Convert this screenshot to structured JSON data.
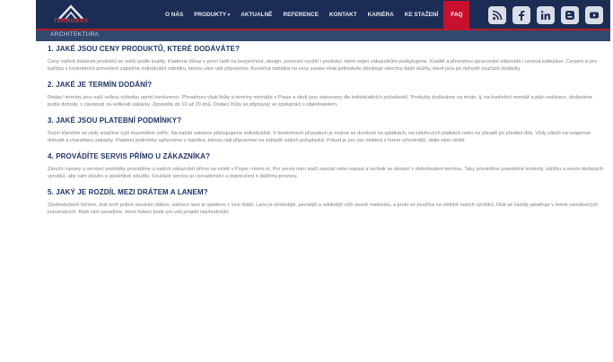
{
  "header": {
    "logo_text": "TERMOBOX",
    "nav": [
      {
        "label": "O NÁS"
      },
      {
        "label": "PRODUKTY",
        "caret": "▾"
      },
      {
        "label": "AKTUALNĚ"
      },
      {
        "label": "REFERENCE"
      },
      {
        "label": "KONTAKT"
      },
      {
        "label": "KARIÉRA"
      },
      {
        "label": "KE STAŽENÍ"
      },
      {
        "label": "FAQ",
        "active": true
      }
    ],
    "social_icons": [
      "rss-icon",
      "facebook-icon",
      "linkedin-icon",
      "blogger-icon",
      "youtube-icon"
    ]
  },
  "subbar": {
    "label": "ARCHITEKTURA"
  },
  "faq": [
    {
      "question": "1. JAKÉ JSOU CENY PRODUKTŮ, KTERÉ DODÁVÁTE?",
      "answer": "Ceny našich dodávek produktů se neliší podle kvality. Klademe důraz v první řadě na bezpečnost, design, provozní využití i produkci, které nejen zákazníkům poskytujeme. Kvalitě a přesnému zpracování odpovídá i cenová kalkulace. Cenami si pro každou z konkrétních provedení zajistíme individuální nabídku, kterou vám rádi připravíme. Konečná nabídka na ceny sestav však jednoduše obsahuje všechny další služby, které jsou po dohodě součástí dodávky."
    },
    {
      "question": "2. JAKÉ JE TERMÍN DODÁNÍ?",
      "answer": "Dodací termíny jsou naší velkou výhodou oproti konkurenci. Přesahnou však lhůty a termíny montáže v Praze a okolí jsou stanoveny dle individuálních požadavků. Produkty dodáváme na místo, tj. na konkrétní montáž a plán realizace, dodáváme podle dohody, v závislosti na velikosti zakázky. Zpravidla do 10 až 20 dnů. Dodací lhůty se připravují ve spolupráci s objednatelem."
    },
    {
      "question": "3. JAKÉ JSOU PLATEBNÍ PODMÍNKY?",
      "answer": "Svým klientům se vždy snažíme vyjít maximálně vstříc. Na každé zakázce přistupujeme individuálně. V konkrétních případech je možné se domluvit na splátkách, na zálohových platbách nebo na úhradě po předání díla. Vždy záleží na vzájemné dohodě a charakteru zakázky. Platební podmínky upřesníme v nabídce, kterou rádi připravíme na základě vašich požadavků. Pokud je pro vás některá z forem výhodnější, dejte nám vědět."
    },
    {
      "question": "4. PROVÁDÍTE SERVIS PŘÍMO U ZÁKAZNÍKA?",
      "answer": "Záruční opravy a servisní prohlídky provádíme u našich zákazníků přímo na místě v Praze i mimo ni. Pro servis nám stačí zavolat nebo napsat a technik se dostaví v dohodnutém termínu. Taky provádíme pravidelné kontroly, údržbu a revize dodaných výrobků, aby vám dlouho a spolehlivě sloužily. Součástí servisu je i poradenství a doporučení k dalšímu provozu."
    },
    {
      "question": "5. JAKÝ JE ROZDÍL MEZI DRÁTEM A LANEM?",
      "answer": "Zjednodušeně řečeno, drát tvoří jediné souvislé vlákno, zatímco lano je spleteno z více drátů. Lano je ohebnější, pevnější a odolnější vůči únavě materiálu, a proto se používá na většině našich výrobků. Drát se častěji uplatňuje v méně namáhaných konstrukcích. Rádi vám poradíme, které řešení bude pro váš projekt nejvhodnější."
    }
  ]
}
